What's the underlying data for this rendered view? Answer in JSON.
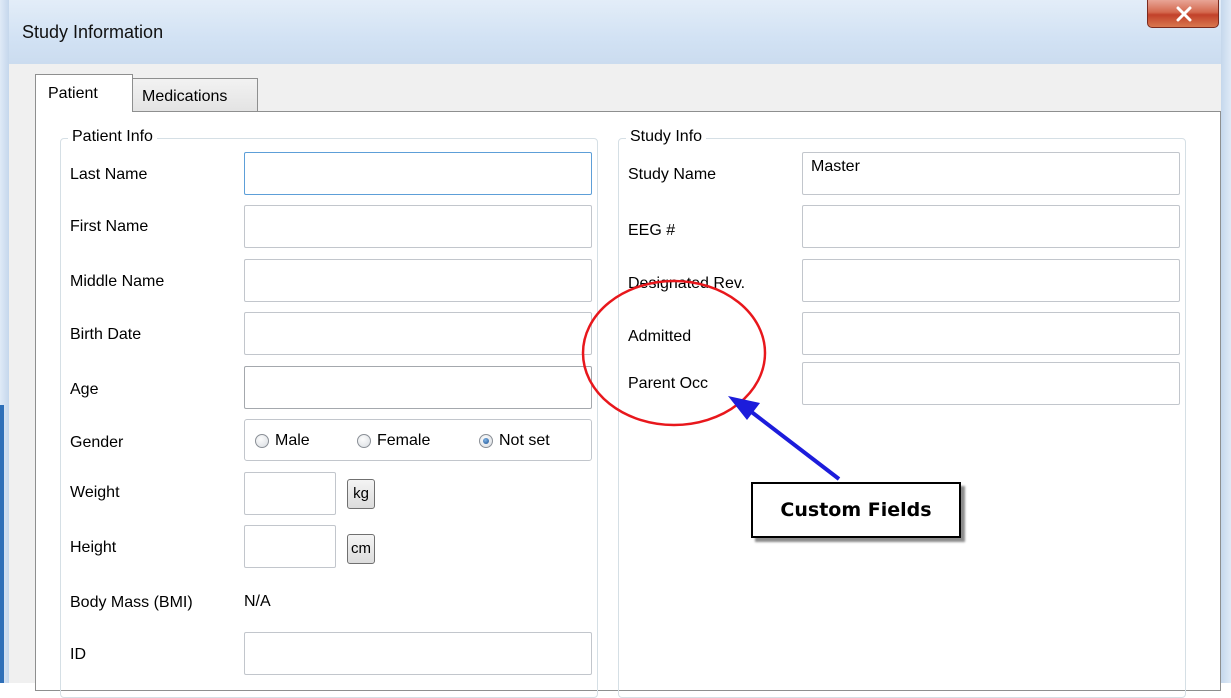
{
  "window": {
    "title": "Study Information",
    "close_icon": "close-x-icon"
  },
  "tabs": [
    {
      "label": "Patient",
      "active": true
    },
    {
      "label": "Medications",
      "active": false
    }
  ],
  "patient_info": {
    "legend": "Patient Info",
    "last_name_label": "Last Name",
    "last_name_value": "",
    "first_name_label": "First Name",
    "first_name_value": "",
    "middle_name_label": "Middle Name",
    "middle_name_value": "",
    "birth_date_label": "Birth Date",
    "birth_date_value": "",
    "age_label": "Age",
    "age_value": "",
    "gender_label": "Gender",
    "gender_options": [
      "Male",
      "Female",
      "Not set"
    ],
    "gender_selected": "Not set",
    "weight_label": "Weight",
    "weight_value": "",
    "weight_unit": "kg",
    "height_label": "Height",
    "height_value": "",
    "height_unit": "cm",
    "bmi_label": "Body Mass (BMI)",
    "bmi_value": "N/A",
    "id_label": "ID",
    "id_value": ""
  },
  "study_info": {
    "legend": "Study Info",
    "study_name_label": "Study Name",
    "study_name_value": "Master",
    "eeg_label": "EEG #",
    "eeg_value": "",
    "designated_label": "Designated Rev.",
    "designated_value": "",
    "admitted_label": "Admitted",
    "admitted_value": "",
    "parent_occ_label": "Parent Occ",
    "parent_occ_value": ""
  },
  "annotation": {
    "callout_text": "Custom Fields",
    "ellipse_color": "#e8171c",
    "arrow_color": "#1c1cdb"
  }
}
